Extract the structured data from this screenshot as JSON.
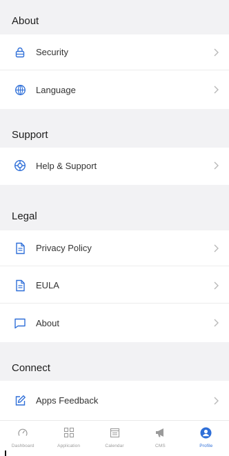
{
  "colors": {
    "accent": "#2f6fd8",
    "section_bg": "#f2f2f4",
    "divider": "#ececec"
  },
  "sections": {
    "about": {
      "title": "About",
      "items": [
        {
          "label": "Security",
          "icon": "lock-icon"
        },
        {
          "label": "Language",
          "icon": "globe-icon"
        }
      ]
    },
    "support": {
      "title": "Support",
      "items": [
        {
          "label": "Help & Support",
          "icon": "lifebuoy-icon"
        }
      ]
    },
    "legal": {
      "title": "Legal",
      "items": [
        {
          "label": "Privacy Policy",
          "icon": "document-icon"
        },
        {
          "label": "EULA",
          "icon": "document-icon"
        },
        {
          "label": "About",
          "icon": "message-icon"
        }
      ]
    },
    "connect": {
      "title": "Connect",
      "items": [
        {
          "label": "Apps Feedback",
          "icon": "edit-icon"
        }
      ]
    }
  },
  "tabbar": {
    "tabs": [
      {
        "label": "Dashboard",
        "icon": "gauge-icon"
      },
      {
        "label": "Application",
        "icon": "grid-icon"
      },
      {
        "label": "Calendar",
        "icon": "calendar-icon"
      },
      {
        "label": "CMS",
        "icon": "megaphone-icon"
      },
      {
        "label": "Profile",
        "icon": "profile-icon"
      }
    ],
    "active": "Profile"
  }
}
